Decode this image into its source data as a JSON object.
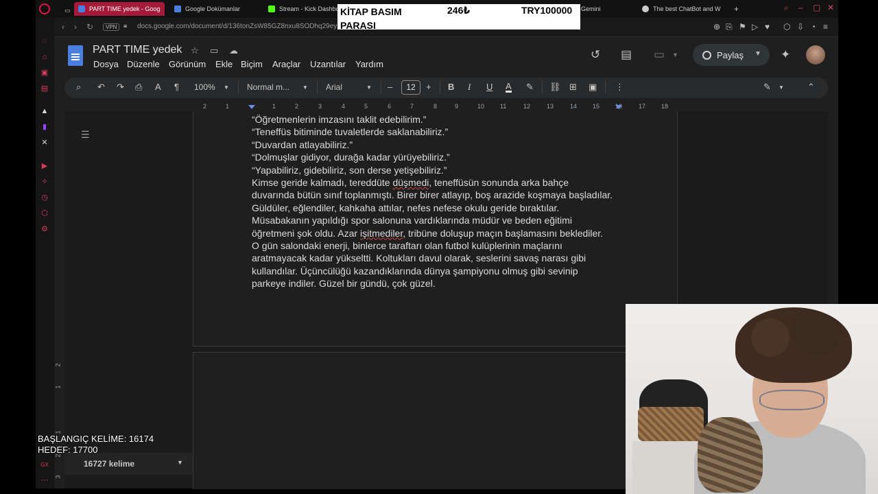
{
  "browser": {
    "tabs": [
      {
        "label": "PART TIME yedek - Goog",
        "active": true,
        "color": "#4a7fe0"
      },
      {
        "label": "Google Dokümanlar",
        "active": false,
        "color": "#4a7fe0"
      },
      {
        "label": "Stream - Kick Dashbo",
        "active": false,
        "color": "#53fc18"
      },
      {
        "label": "Gemini",
        "active": false,
        "color": "#888888"
      },
      {
        "label": "The best ChatBot and W",
        "active": false,
        "color": "#cccccc"
      }
    ],
    "new_tab": "+",
    "vpn": "VPN",
    "url": "docs.google.com/document/d/136tonZsW85GZ8nxu8SODhq29ey"
  },
  "docs": {
    "title": "PART TIME yedek",
    "menus": [
      "Dosya",
      "Düzenle",
      "Görünüm",
      "Ekle",
      "Biçim",
      "Araçlar",
      "Uzantılar",
      "Yardım"
    ],
    "share_label": "Paylaş",
    "toolbar": {
      "zoom": "100%",
      "style": "Normal m...",
      "font": "Arial",
      "font_size": "12"
    },
    "ruler_numbers": [
      "2",
      "1",
      "1",
      "2",
      "3",
      "4",
      "5",
      "6",
      "7",
      "8",
      "9",
      "10",
      "11",
      "12",
      "13",
      "14",
      "15",
      "16",
      "17",
      "18"
    ],
    "vruler_numbers": [
      "2",
      "1",
      "1",
      "2",
      "3"
    ],
    "lines": [
      [
        {
          "t": "“Öğretmenlerin imzasını taklit edebilirim.”"
        }
      ],
      [
        {
          "t": "“Teneffüs bitiminde tuvaletlerde saklanabiliriz.”"
        }
      ],
      [
        {
          "t": "“Duvardan atlayabiliriz.”"
        }
      ],
      [
        {
          "t": "“Dolmuşlar gidiyor, durağa kadar yürüyebiliriz.”"
        }
      ],
      [
        {
          "t": "“Yapabiliriz, gidebiliriz, son derse yetişebiliriz.”"
        }
      ],
      [
        {
          "t": "Kimse geride kalmadı, tereddüte "
        },
        {
          "t": "düşmedi",
          "sq": true
        },
        {
          "t": ", teneffüsün sonunda arka bahçe"
        }
      ],
      [
        {
          "t": "duvarında bütün sınıf toplanmıştı. Birer birer atlayıp, boş arazide koşmaya başladılar."
        }
      ],
      [
        {
          "t": "Güldüler, eğlendiler, kahkaha attılar, nefes nefese okulu geride bıraktılar."
        }
      ],
      [
        {
          "t": "Müsabakanın yapıldığı spor salonuna vardıklarında müdür ve beden eğitimi"
        }
      ],
      [
        {
          "t": "öğretmeni şok oldu. Azar "
        },
        {
          "t": "işitmediler",
          "sq": true
        },
        {
          "t": ", tribüne doluşup maçın başlamasını beklediler."
        }
      ],
      [
        {
          "t": "O gün salondaki enerji, binlerce taraftarı olan futbol kulüplerinin maçlarını"
        }
      ],
      [
        {
          "t": "aratmayacak kadar yükseltti. Koltukları davul olarak, seslerini savaş narası gibi"
        }
      ],
      [
        {
          "t": "kullandılar. Üçüncülüğü kazandıklarında dünya şampiyonu olmuş gibi sevinip"
        }
      ],
      [
        {
          "t": "parkeye indiler. Güzel bir gündü, çok güzel."
        }
      ]
    ],
    "word_count": "16727 kelime"
  },
  "overlay": {
    "donation": {
      "name": "KİTAP BASIM PARASI",
      "amount": "246₺",
      "currency_amount": "TRY100000"
    },
    "start_words": "BAŞLANGIÇ KELİME: 16174",
    "goal": "HEDEF: 17700"
  },
  "icons": {
    "sidebar": [
      "opera-aria-icon",
      "extension-icon",
      "messenger-icon",
      "wallet-icon",
      "tweet-icon",
      "twitch-icon",
      "x-icon",
      "player-icon",
      "pin-icon",
      "history-icon",
      "extensions-icon",
      "settings-icon"
    ]
  },
  "colors": {
    "accent": "#a51a3b",
    "opera": "#e0134f",
    "docs_blue": "#4a7fe0"
  }
}
